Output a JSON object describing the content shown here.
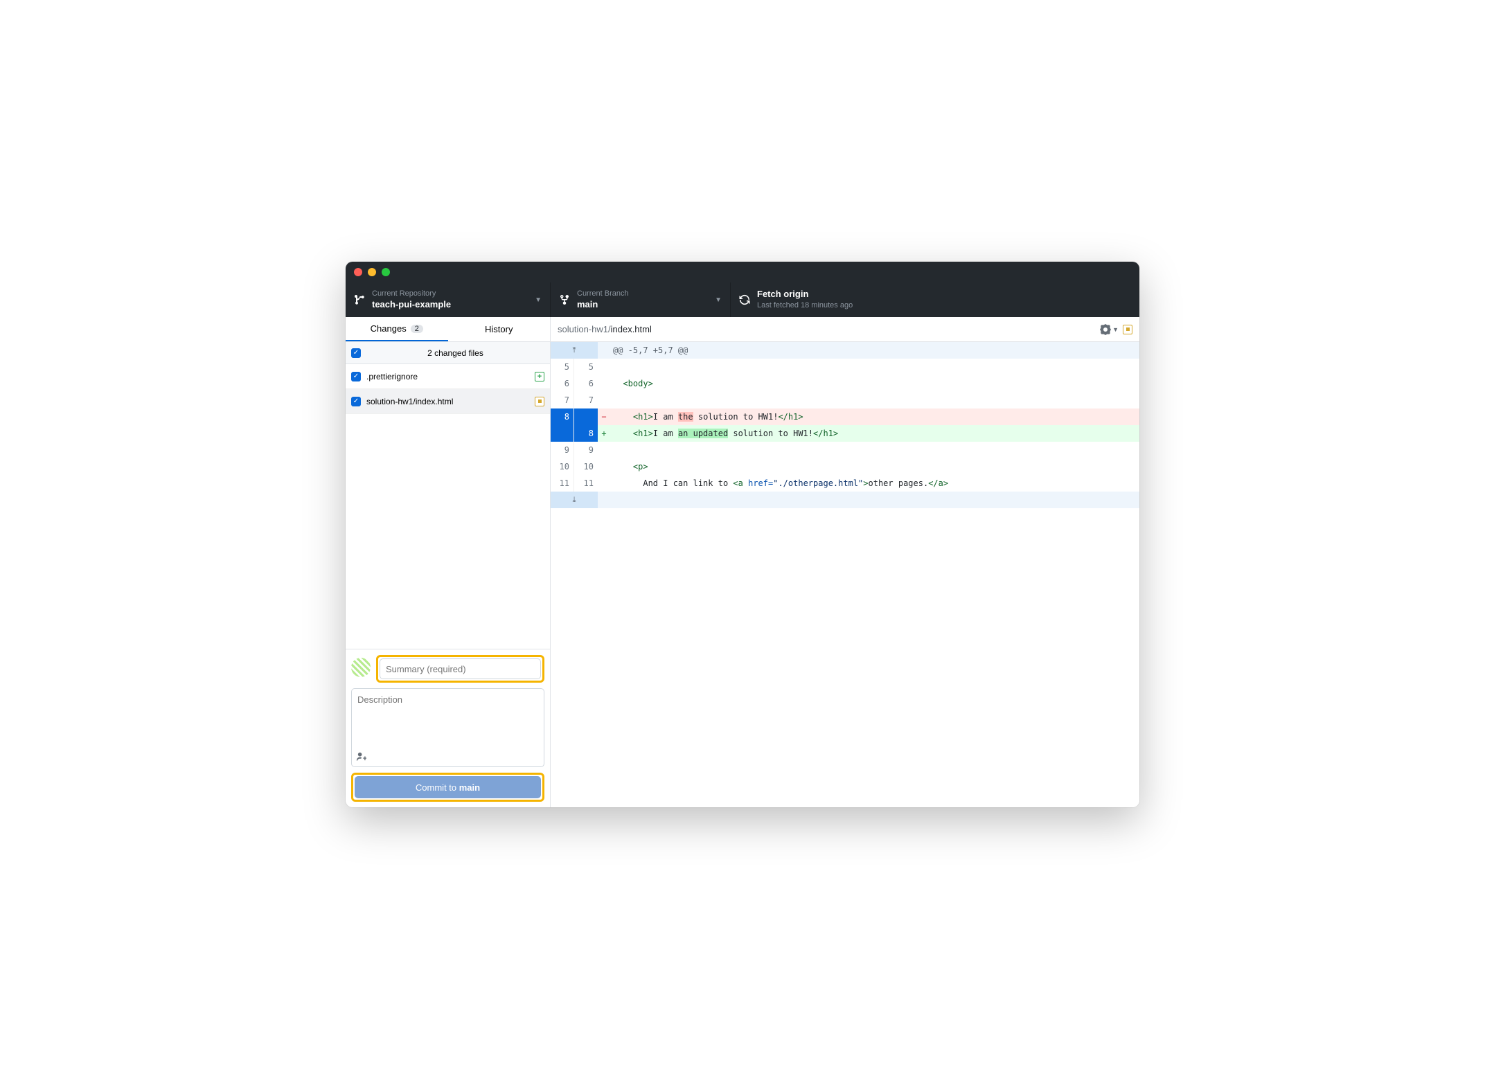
{
  "toolbar": {
    "repo": {
      "label": "Current Repository",
      "value": "teach-pui-example"
    },
    "branch": {
      "label": "Current Branch",
      "value": "main"
    },
    "fetch": {
      "label": "Fetch origin",
      "status": "Last fetched 18 minutes ago"
    }
  },
  "tabs": {
    "changes": "Changes",
    "changes_count": "2",
    "history": "History"
  },
  "changes": {
    "header": "2 changed files",
    "files": [
      {
        "name": ".prettierignore",
        "status": "added",
        "selected": false
      },
      {
        "name": "solution-hw1/index.html",
        "status": "modified",
        "selected": true
      }
    ]
  },
  "commit": {
    "summary_placeholder": "Summary (required)",
    "desc_placeholder": "Description",
    "button_prefix": "Commit to ",
    "button_branch": "main"
  },
  "diff": {
    "path_dir": "solution-hw1/",
    "path_file": "index.html",
    "hunk": "@@ -5,7 +5,7 @@",
    "lines": [
      {
        "type": "ctx",
        "old": "5",
        "new": "5",
        "text": ""
      },
      {
        "type": "ctx",
        "old": "6",
        "new": "6",
        "html": "  <span class='tok-tag'>&lt;body&gt;</span>"
      },
      {
        "type": "ctx",
        "old": "7",
        "new": "7",
        "text": ""
      },
      {
        "type": "del",
        "old": "8",
        "new": "",
        "html": "    <span class='tok-tag'>&lt;h1&gt;</span><span class='tok-txt'>I am </span><span class='word-del tok-txt'>the</span><span class='tok-txt'> solution to HW1!</span><span class='tok-tag'>&lt;/h1&gt;</span>"
      },
      {
        "type": "add",
        "old": "",
        "new": "8",
        "html": "    <span class='tok-tag'>&lt;h1&gt;</span><span class='tok-txt'>I am </span><span class='word-add tok-txt'>an updated</span><span class='tok-txt'> solution to HW1!</span><span class='tok-tag'>&lt;/h1&gt;</span>"
      },
      {
        "type": "ctx",
        "old": "9",
        "new": "9",
        "text": ""
      },
      {
        "type": "ctx",
        "old": "10",
        "new": "10",
        "html": "    <span class='tok-tag'>&lt;p&gt;</span>"
      },
      {
        "type": "ctx",
        "old": "11",
        "new": "11",
        "html": "      <span class='tok-txt'>And I can link to </span><span class='tok-tag'>&lt;a </span><span class='tok-attr'>href=</span><span class='tok-str'>\"./otherpage.html\"</span><span class='tok-tag'>&gt;</span><span class='tok-txt'>other pages.</span><span class='tok-tag'>&lt;/a&gt;</span>"
      }
    ]
  }
}
